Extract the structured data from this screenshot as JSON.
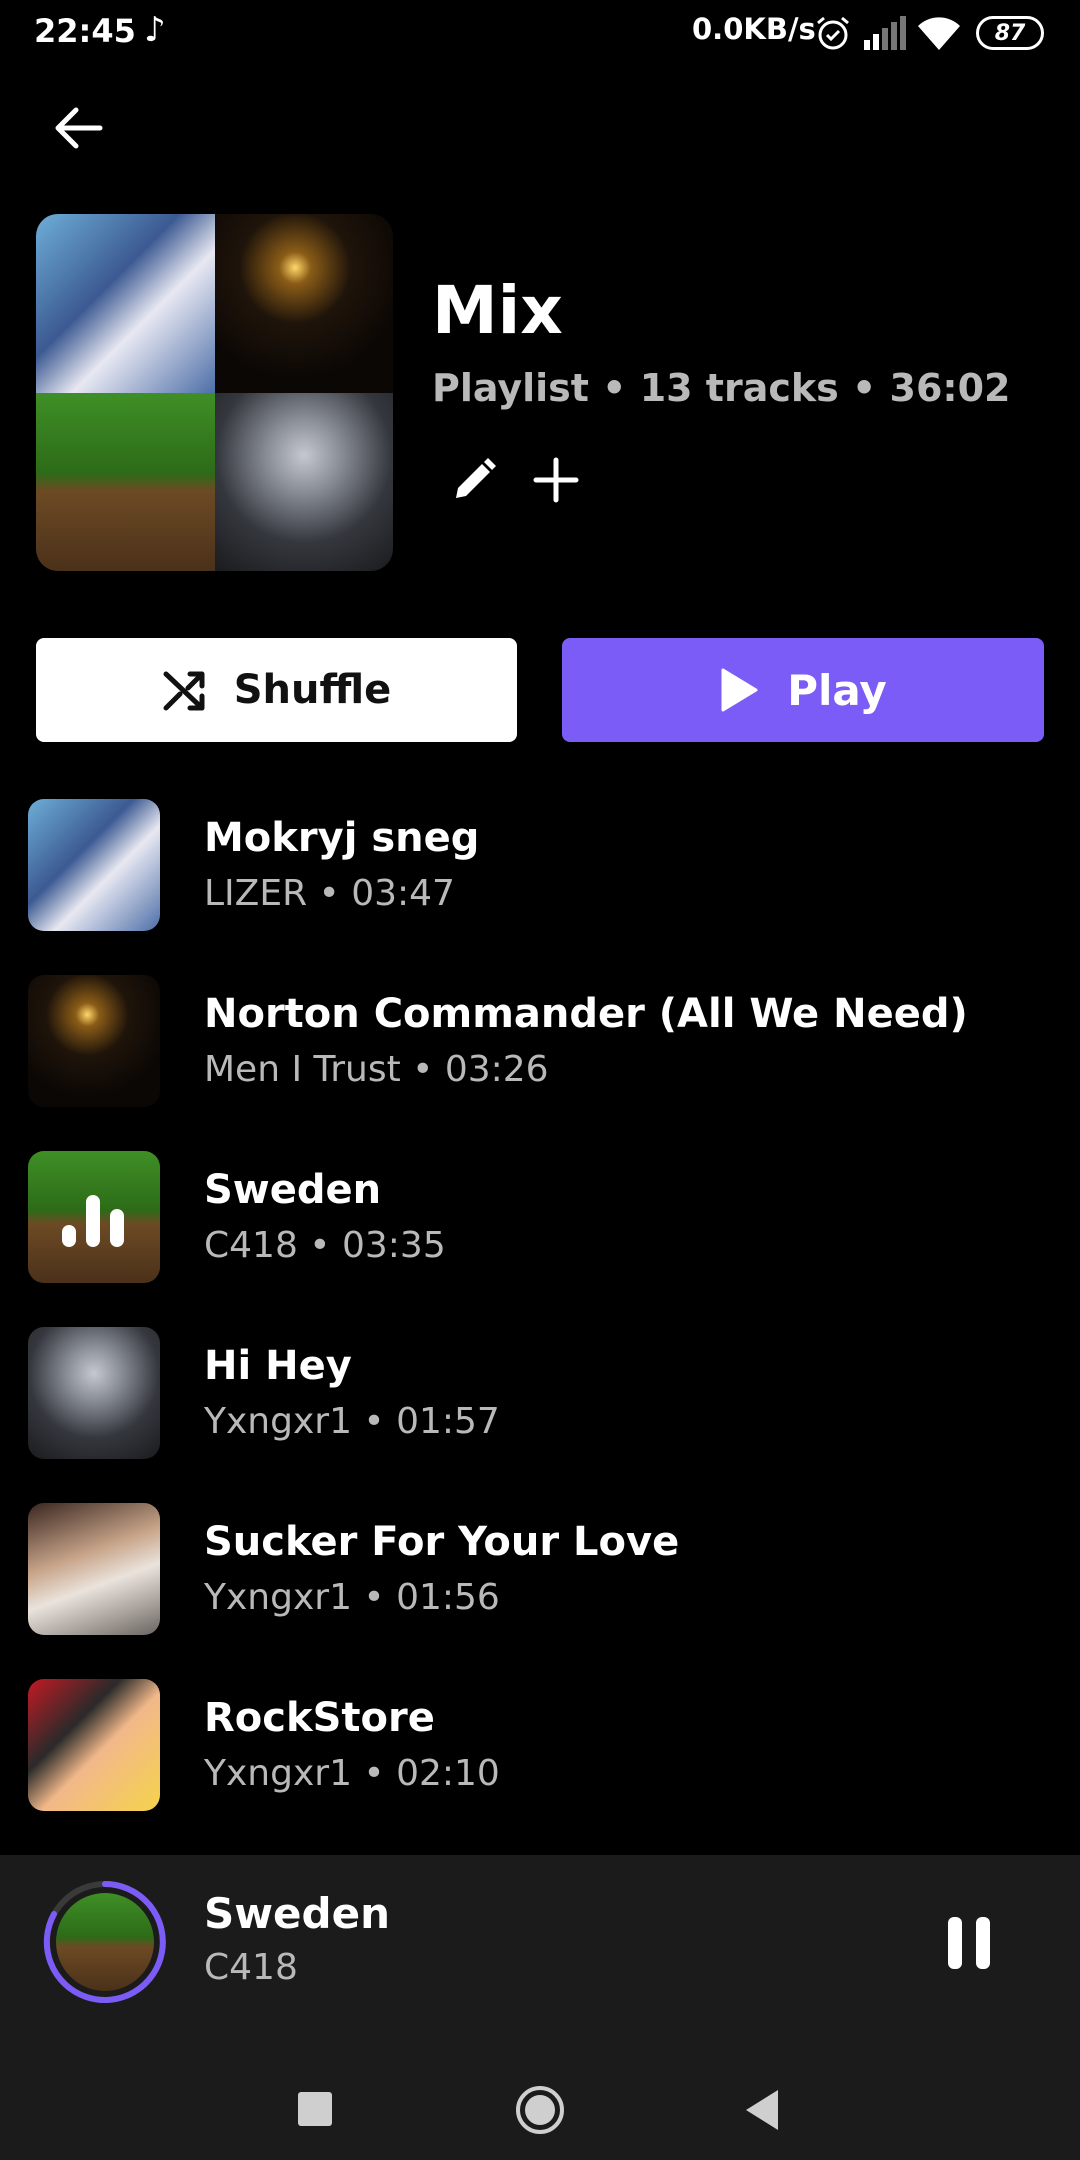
{
  "status_bar": {
    "time": "22:45",
    "music_note": "♪",
    "network_speed": "0.0KB/s",
    "battery": "87"
  },
  "playlist": {
    "title": "Mix",
    "meta": "Playlist • 13 tracks • 36:02"
  },
  "actions": {
    "shuffle_label": "Shuffle",
    "play_label": "Play"
  },
  "tracks": [
    {
      "title": "Mokryj sneg",
      "subtitle": "LIZER • 03:47"
    },
    {
      "title": "Norton Commander (All We Need)",
      "subtitle": "Men I Trust • 03:26"
    },
    {
      "title": "Sweden",
      "subtitle": "C418 • 03:35",
      "playing": true
    },
    {
      "title": "Hi Hey",
      "subtitle": "Yxngxr1 • 01:57"
    },
    {
      "title": "Sucker For Your Love",
      "subtitle": "Yxngxr1 • 01:56"
    },
    {
      "title": "RockStore",
      "subtitle": "Yxngxr1 • 02:10"
    }
  ],
  "now_playing": {
    "title": "Sweden",
    "artist": "C418"
  },
  "colors": {
    "accent": "#7c5cf6",
    "background": "#000000",
    "panel": "#1b1b1b",
    "secondary_text": "#b9b9b9"
  }
}
